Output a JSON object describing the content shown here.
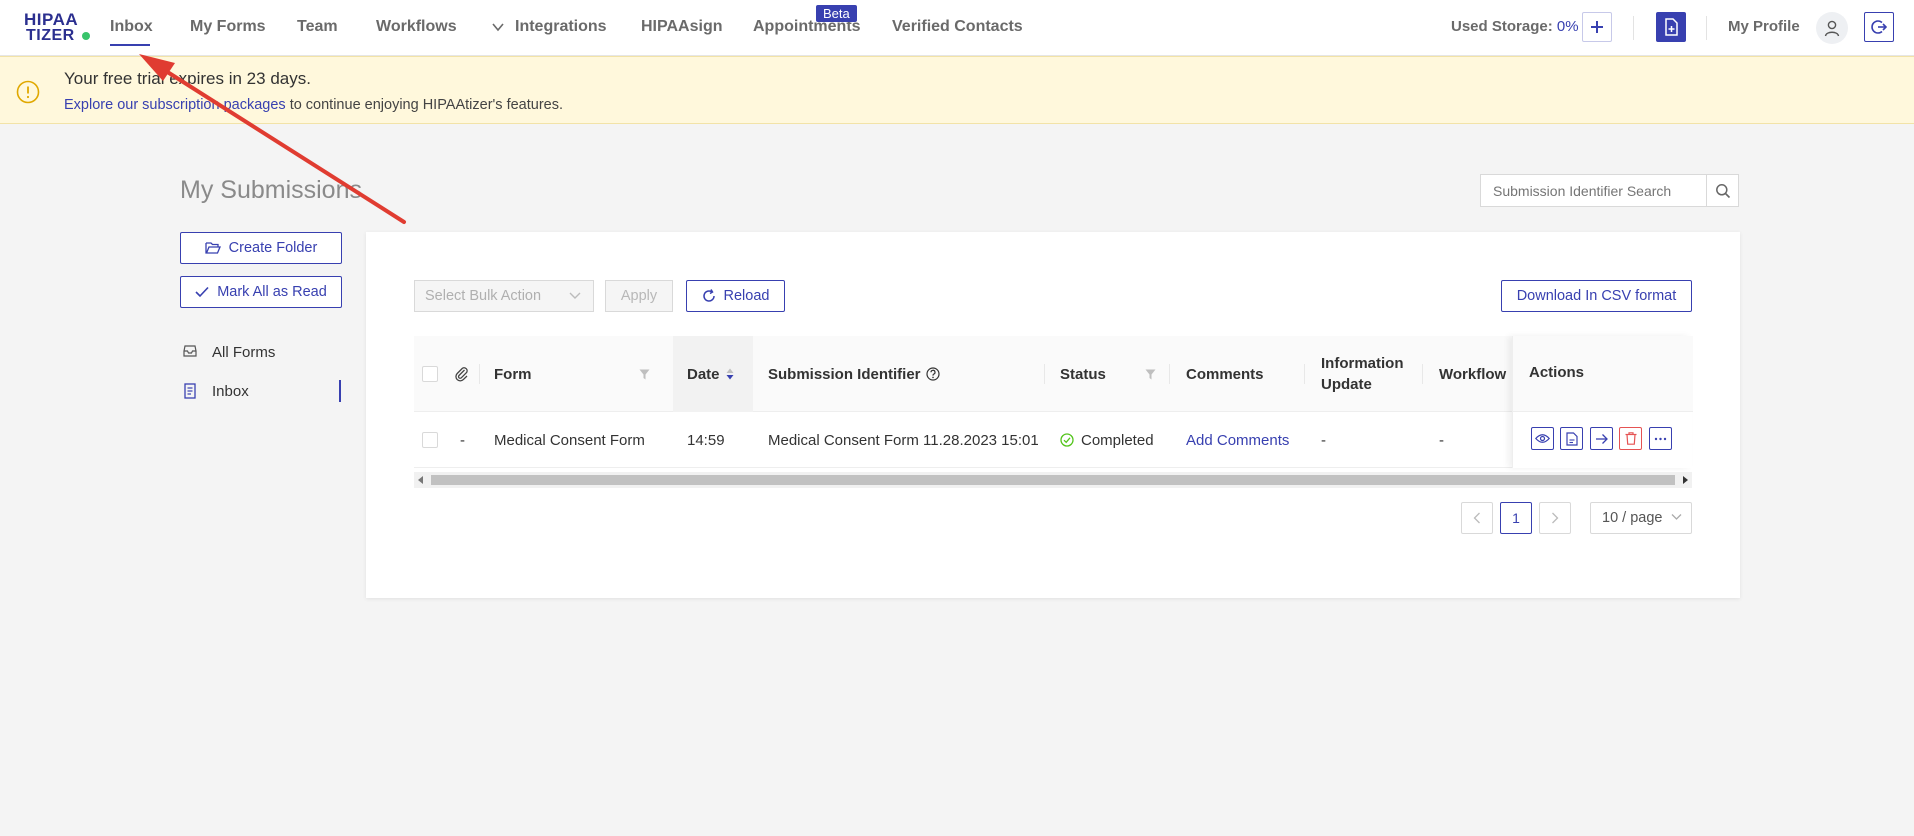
{
  "nav": {
    "logo_line1": "HIPAA",
    "logo_line2": "TIZER",
    "items": [
      "Inbox",
      "My Forms",
      "Team",
      "Workflows",
      "Integrations",
      "HIPAAsign",
      "Appointments",
      "Verified Contacts"
    ],
    "beta_badge": "Beta",
    "storage_label": "Used Storage:",
    "storage_value": "0%",
    "profile_label": "My Profile"
  },
  "banner": {
    "title": "Your free trial expires in 23 days.",
    "link_text": "Explore our subscription packages",
    "rest_text": "to continue enjoying HIPAAtizer's features."
  },
  "page": {
    "title": "My Submissions",
    "search_placeholder": "Submission Identifier Search"
  },
  "sidebar": {
    "create_folder": "Create Folder",
    "mark_all_read": "Mark All as Read",
    "items": [
      "All Forms",
      "Inbox"
    ]
  },
  "toolbar": {
    "bulk_placeholder": "Select Bulk Action",
    "apply": "Apply",
    "reload": "Reload",
    "csv": "Download In CSV format"
  },
  "table": {
    "columns": {
      "form": "Form",
      "date": "Date",
      "identifier": "Submission Identifier",
      "status": "Status",
      "comments": "Comments",
      "info_update_1": "Information",
      "info_update_2": "Update",
      "workflow": "Workflow",
      "actions": "Actions"
    },
    "rows": [
      {
        "attachment": "-",
        "form": "Medical Consent Form",
        "date": "14:59",
        "identifier": "Medical Consent Form 11.28.2023 15:01",
        "status": "Completed",
        "comments": "Add Comments",
        "info_update": "-",
        "workflow": "-"
      }
    ]
  },
  "pagination": {
    "current": "1",
    "page_size": "10 / page"
  },
  "colors": {
    "accent": "#3840b0",
    "banner_bg": "#fff8dc",
    "success": "#52c41a",
    "danger": "#e55353",
    "annotation_arrow": "#e03c31"
  }
}
